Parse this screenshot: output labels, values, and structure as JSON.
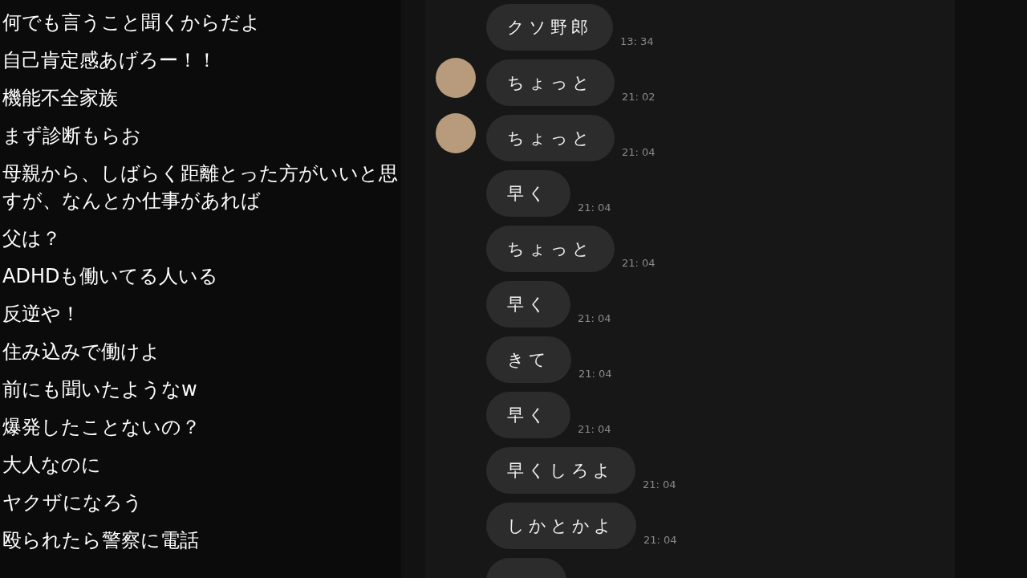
{
  "comments": [
    "何でも言うこと聞くからだよ",
    "自己肯定感あげろー！！",
    "機能不全家族",
    "まず診断もらお",
    "母親から、しばらく距離とった方がいいと思すが、なんとか仕事があれば",
    "父は？",
    "ADHDも働いてる人いる",
    "反逆や！",
    "住み込みで働けよ",
    "前にも聞いたようなw",
    "爆発したことないの？",
    "大人なのに",
    "ヤクザになろう",
    "殴られたら警察に電話"
  ],
  "chat": [
    {
      "text": "クソ野郎",
      "time": "13: 34",
      "avatar": false
    },
    {
      "text": "ちょっと",
      "time": "21: 02",
      "avatar": true
    },
    {
      "text": "ちょっと",
      "time": "21: 04",
      "avatar": true
    },
    {
      "text": "早く",
      "time": "21: 04",
      "avatar": false
    },
    {
      "text": "ちょっと",
      "time": "21: 04",
      "avatar": false
    },
    {
      "text": "早く",
      "time": "21: 04",
      "avatar": false
    },
    {
      "text": "きて",
      "time": "21: 04",
      "avatar": false
    },
    {
      "text": "早く",
      "time": "21: 04",
      "avatar": false
    },
    {
      "text": "早くしろよ",
      "time": "21: 04",
      "avatar": false
    },
    {
      "text": "しかとかよ",
      "time": "21: 04",
      "avatar": false
    }
  ]
}
